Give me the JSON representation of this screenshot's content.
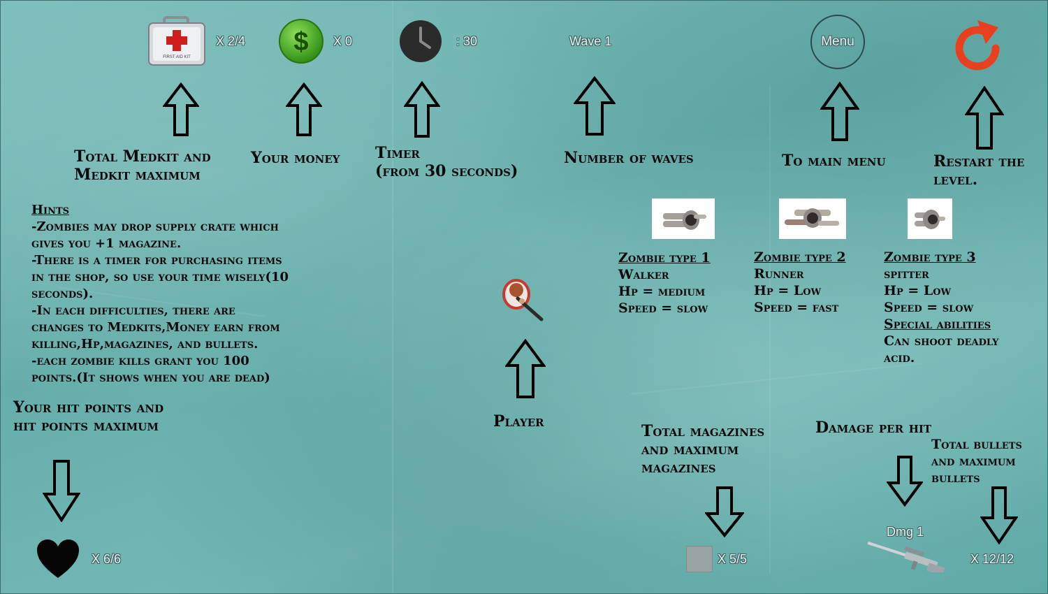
{
  "hud": {
    "medkit_count": "X 2/4",
    "money_count": "X 0",
    "timer": ": 30",
    "wave": "Wave  1",
    "menu_button": "Menu",
    "medkit_box_text": "FIRST AID KIT",
    "money_symbol": "$",
    "hp_count": "X 6/6",
    "magazine_count": "X 5/5",
    "damage": "Dmg 1",
    "bullet_count": "X 12/12"
  },
  "labels": {
    "medkit": [
      "Total Medkit and",
      "Medkit maximum"
    ],
    "money": "Your money",
    "timer": [
      "Timer",
      "(from 30 seconds)"
    ],
    "waves": "Number of waves",
    "main_menu": "To main menu",
    "restart": [
      "Restart the",
      "level."
    ],
    "player": "Player",
    "hit_points": [
      "Your hit points and",
      "hit points maximum"
    ],
    "magazines": [
      "Total magazines",
      "and maximum",
      "magazines"
    ],
    "damage": "Damage per hit",
    "bullets": [
      "Total bullets",
      "and maximum",
      "bullets"
    ]
  },
  "hints": {
    "title": "Hints",
    "lines": [
      "-Zombies may drop supply crate which",
      "gives you +1 magazine.",
      "-There is a timer for purchasing items",
      "in the shop, so use your time wisely(10",
      "seconds).",
      "-In each difficulties, there are",
      "changes to Medkits,Money earn from",
      "killing,Hp,magazines, and bullets.",
      "-each zombie kills grant you 100",
      "points.(It shows when you are dead)"
    ]
  },
  "zombies": [
    {
      "title": "Zombie type 1",
      "lines": [
        "Walker",
        "Hp = medium",
        "Speed = slow"
      ]
    },
    {
      "title": "Zombie type 2",
      "lines": [
        "Runner",
        "Hp = Low",
        "Speed = fast"
      ]
    },
    {
      "title": "Zombie type 3",
      "lines": [
        "spitter",
        "Hp = Low",
        "Speed = slow"
      ],
      "special_title": "Special abilities",
      "special_lines": [
        "Can shoot deadly",
        "acid."
      ]
    }
  ],
  "colors": {
    "background": "#6fb3b1",
    "money_green": "#4caf2a",
    "restart_orange": "#e8401f",
    "label_text": "#0a0a0a",
    "hud_text": "#e7f2f1"
  },
  "icons": [
    "first-aid-kit-icon",
    "dollar-coin-icon",
    "clock-icon",
    "menu-circle-button",
    "restart-icon",
    "heart-icon",
    "magazine-icon",
    "sniper-rifle-icon",
    "player-sprite",
    "zombie-sprite"
  ]
}
